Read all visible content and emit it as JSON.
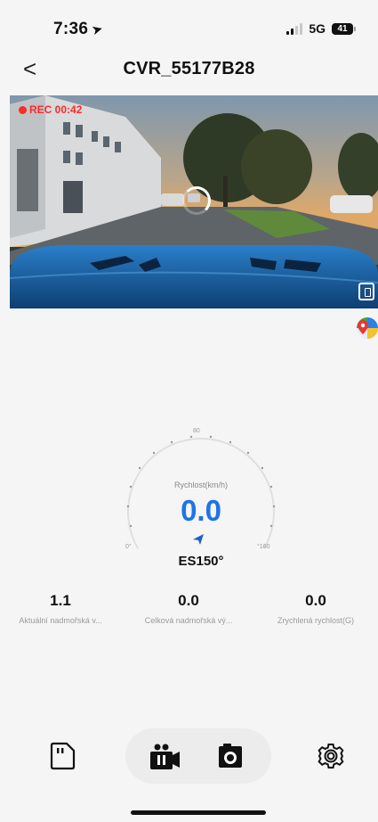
{
  "status_bar": {
    "time": "7:36",
    "network": "5G",
    "battery": "41",
    "icons": [
      "location-arrow-icon",
      "signal-bars-icon",
      "battery-icon"
    ]
  },
  "header": {
    "back_label": "<",
    "title": "CVR_55177B28"
  },
  "video": {
    "rec_label": "REC 00:42",
    "icons": [
      "loading-spinner-icon",
      "fullscreen-icon"
    ]
  },
  "map_button": {
    "icon": "map-pin-icon"
  },
  "speedometer": {
    "label": "Rychlost(km/h)",
    "speed": "0.0",
    "min_label": "0°",
    "mid_label": "80",
    "max_label": "°160",
    "heading": "ES150°",
    "icon": "heading-arrow-icon"
  },
  "stats": [
    {
      "value": "1.1",
      "label": "Aktuální nadmořská v..."
    },
    {
      "value": "0.0",
      "label": "Celková nadmořská vý..."
    },
    {
      "value": "0.0",
      "label": "Zrychlená rychlost(G)"
    }
  ],
  "toolbar": {
    "icons": [
      "sd-card-icon",
      "video-record-icon",
      "camera-icon",
      "gear-icon"
    ],
    "colors": {
      "group_bg": "#ececec",
      "icon": "#111111"
    }
  },
  "colors": {
    "accent": "#1e73e8",
    "rec": "#ff2a2a",
    "background": "#f5f5f5"
  }
}
